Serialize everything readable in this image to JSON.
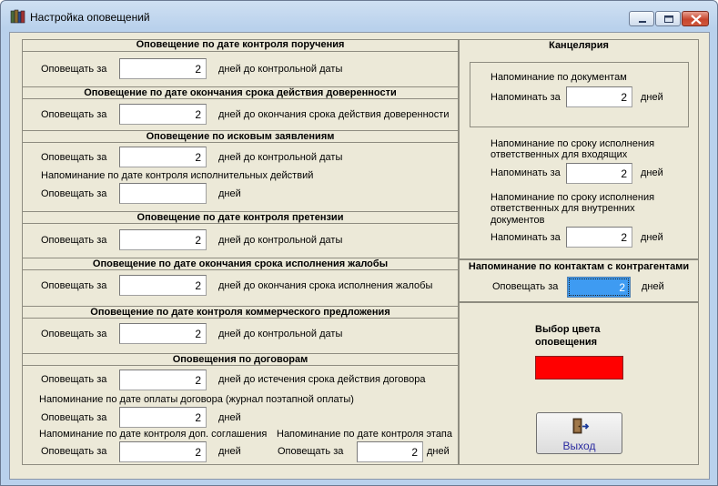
{
  "window": {
    "title": "Настройка оповещений",
    "colors": {
      "selection": "#3e9bf2",
      "alert_color": "#ff0000",
      "face": "#ece9d8"
    }
  },
  "sections": {
    "order_control": {
      "header": "Оповещение по дате контроля поручения",
      "label": "Оповещать за",
      "value": "2",
      "suffix": "дней до контрольной даты"
    },
    "power_of_attorney": {
      "header": "Оповещение по дате окончания срока действия доверенности",
      "label": "Оповещать за",
      "value": "2",
      "suffix": "дней до окончания срока действия доверенности"
    },
    "claims": {
      "header": "Оповещение по исковым заявлениям",
      "label": "Оповещать за",
      "value": "2",
      "suffix": "дней до контрольной даты",
      "enforcement_caption": "Напоминание по дате контроля исполнительных действий",
      "enforcement_label": "Оповещать за",
      "enforcement_value": "",
      "enforcement_suffix": "дней"
    },
    "pretension": {
      "header": "Оповещение по дате контроля претензии",
      "label": "Оповещать за",
      "value": "2",
      "suffix": "дней до контрольной даты"
    },
    "complaint": {
      "header": "Оповещение по дате окончания срока исполнения жалобы",
      "label": "Оповещать за",
      "value": "2",
      "suffix": "дней до окончания срока исполнения жалобы"
    },
    "commercial_offer": {
      "header": "Оповещение по дате контроля коммерческого предложения",
      "label": "Оповещать за",
      "value": "2",
      "suffix": "дней до контрольной даты"
    },
    "contracts": {
      "header": "Оповещения по договорам",
      "label": "Оповещать за",
      "value": "2",
      "suffix": "дней до истечения срока действия договора",
      "payment_caption": "Напоминание по дате оплаты договора (журнал поэтапной оплаты)",
      "payment_label": "Оповещать за",
      "payment_value": "2",
      "payment_suffix": "дней",
      "addendum_caption": "Напоминание по дате контроля доп. соглашения",
      "addendum_label": "Оповещать за",
      "addendum_value": "2",
      "addendum_suffix": "дней",
      "stage_caption": "Напоминание по дате контроля этапа",
      "stage_label": "Оповещать за",
      "stage_value": "2",
      "stage_suffix": "дней"
    }
  },
  "office": {
    "header": "Канцелярия",
    "documents_caption": "Напоминание по документам",
    "documents_label": "Напоминать за",
    "documents_value": "2",
    "documents_suffix": "дней",
    "incoming_caption_1": "Напоминание по сроку исполнения",
    "incoming_caption_2": "ответственных для входящих",
    "incoming_label": "Напоминать за",
    "incoming_value": "2",
    "incoming_suffix": "дней",
    "internal_caption_1": "Напоминание по сроку исполнения",
    "internal_caption_2": "ответственных для внутренних",
    "internal_caption_3": "документов",
    "internal_label": "Напоминать за",
    "internal_value": "2",
    "internal_suffix": "дней"
  },
  "contacts": {
    "header": "Напоминание по контактам с контрагентами",
    "label": "Оповещать за",
    "value": "2",
    "suffix": "дней"
  },
  "color_picker": {
    "caption_1": "Выбор цвета",
    "caption_2": "оповещения"
  },
  "exit": {
    "label": "Выход",
    "icon": "exit-door-icon"
  }
}
